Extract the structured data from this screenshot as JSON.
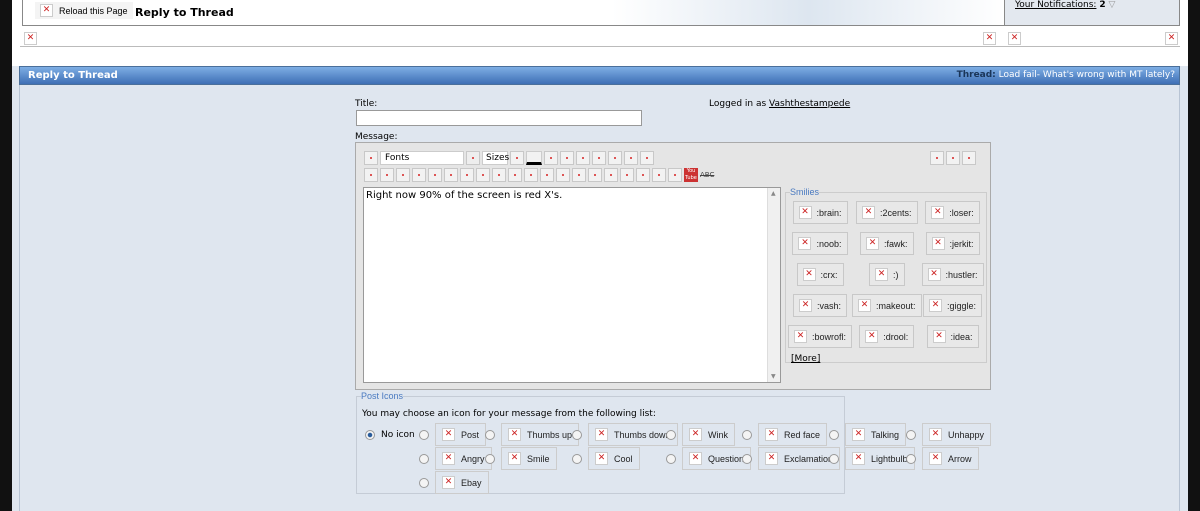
{
  "header": {
    "reload_label": "Reload this Page",
    "page_title": "Reply to Thread",
    "notifications_label": "Your Notifications:",
    "notifications_count": "2"
  },
  "panel": {
    "title": "Reply to Thread",
    "thread_label": "Thread:",
    "thread_title": "Load fail- What's wrong with MT lately?"
  },
  "form": {
    "title_label": "Title:",
    "title_value": "",
    "logged_in_label": "Logged in as",
    "username": "Vashthestampede",
    "message_label": "Message:",
    "fonts_label": "Fonts",
    "sizes_label": "Sizes",
    "youtube_label": "You Tube",
    "spell_label": "ABC",
    "message_value": "Right now 90% of the screen is red X's."
  },
  "smilies": {
    "legend": "Smilies",
    "items": [
      ":brain:",
      ":2cents:",
      ":loser:",
      ":noob:",
      ":fawk:",
      ":jerkit:",
      ":crx:",
      ":)",
      ":hustler:",
      ":vash:",
      ":makeout:",
      ":giggle:",
      ":bowrofl:",
      ":drool:",
      ":idea:"
    ],
    "more_label": "[More]"
  },
  "post_icons": {
    "legend": "Post Icons",
    "instructions": "You may choose an icon for your message from the following list:",
    "no_icon_label": "No icon",
    "selected": "No icon",
    "items": [
      "Post",
      "Thumbs up",
      "Thumbs down",
      "Wink",
      "Red face",
      "Talking",
      "Unhappy",
      "Angry",
      "Smile",
      "Cool",
      "Question",
      "Exclamation",
      "Lightbulb",
      "Arrow",
      "Ebay"
    ]
  }
}
